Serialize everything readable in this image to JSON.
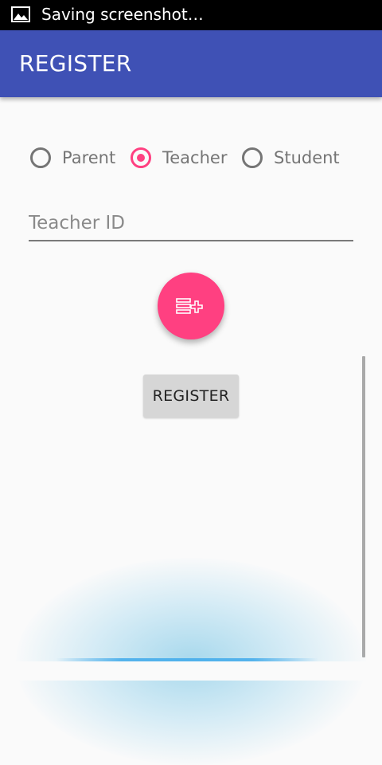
{
  "status_bar": {
    "notification_icon": "image-icon",
    "text": "Saving screenshot…"
  },
  "app_bar": {
    "title": "REGISTER",
    "color": "#3f51b5"
  },
  "role_selector": {
    "options": [
      {
        "label": "Parent",
        "checked": false
      },
      {
        "label": "Teacher",
        "checked": true
      },
      {
        "label": "Student",
        "checked": false
      }
    ],
    "accent_color": "#ff4081"
  },
  "id_field": {
    "placeholder": "Teacher ID",
    "value": ""
  },
  "fab": {
    "icon": "playlist-add-icon",
    "color": "#ff4081"
  },
  "register_button": {
    "label": "REGISTER"
  }
}
